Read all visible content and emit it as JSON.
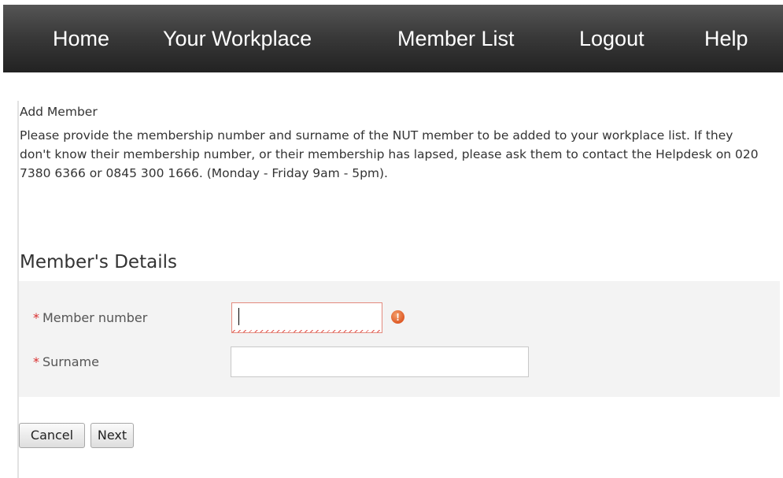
{
  "nav": {
    "items": [
      {
        "label": "Home"
      },
      {
        "label": "Your Workplace"
      },
      {
        "label": "Member List"
      },
      {
        "label": "Logout"
      },
      {
        "label": "Help"
      }
    ]
  },
  "page": {
    "heading": "Add Member",
    "intro": "Please provide the membership number and surname of the NUT member to be added to your workplace list. If they don't know their membership number, or their membership has lapsed, please ask them to contact the Helpdesk on 020 7380 6366 or 0845 300 1666. (Monday - Friday 9am - 5pm)."
  },
  "form": {
    "section_title": "Member's Details",
    "required_marker": "*",
    "member_number": {
      "label": "Member number",
      "value": "",
      "state": "error"
    },
    "surname": {
      "label": "Surname",
      "value": ""
    },
    "error_icon_glyph": "!"
  },
  "buttons": {
    "cancel": "Cancel",
    "next": "Next"
  },
  "colors": {
    "nav_background": "#333333",
    "required": "#d92f2f",
    "error_border": "#e38a7d",
    "error_icon": "#de5a26",
    "form_background": "#f3f3f3"
  },
  "icons": [
    "error-icon"
  ]
}
